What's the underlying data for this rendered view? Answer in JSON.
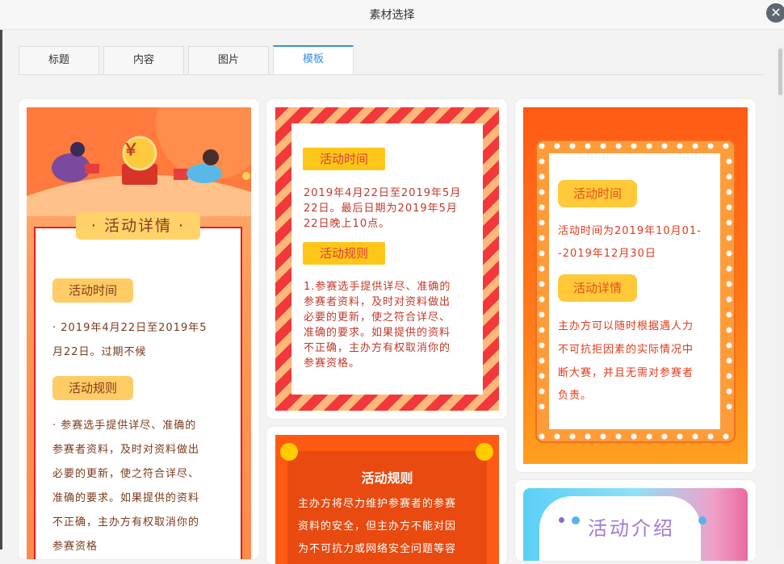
{
  "dialog": {
    "title": "素材选择",
    "close_symbol": "✕"
  },
  "tabs": [
    {
      "label": "标题",
      "active": false
    },
    {
      "label": "内容",
      "active": false
    },
    {
      "label": "图片",
      "active": false
    },
    {
      "label": "模板",
      "active": true
    }
  ],
  "colors": {
    "accent": "#3a8ee6",
    "template_red": "#e03b3b",
    "orange": "#ff6a1a",
    "yellow": "#ffd057"
  },
  "templates": {
    "t1": {
      "coin_symbol": "￥",
      "banner": "· 活动详情 ·",
      "time_heading": "活动时间",
      "time_text_1": "· 2019年4月22日至2019年5",
      "time_text_2": "月22日。过期不候",
      "rules_heading": "活动规则",
      "rules_lines": [
        "· 参赛选手提供详尽、准确的",
        "参赛者资料，及时对资料做出",
        "必要的更新，使之符合详尽、",
        "准确的要求。如果提供的资料",
        "不正确，主办方有权取消你的",
        "参赛资格"
      ]
    },
    "t2": {
      "time_heading": "活动时间",
      "time_lines": [
        "2019年4月22日至2019年5月",
        "22日。最后日期为2019年5月",
        "22日晚上10点。"
      ],
      "rules_heading": "活动规则",
      "rules_lines": [
        "1.参赛选手提供详尽、准确的",
        "参赛者资料，及时对资料做出",
        "必要的更新，使之符合详尽、",
        "准确的要求。如果提供的资料",
        "不正确，主办方有权取消你的",
        "参赛资格。"
      ]
    },
    "t3": {
      "time_heading": "活动时间",
      "time_lines": [
        "活动时间为2019年10月01-",
        "-2019年12月30日"
      ],
      "detail_heading": "活动详情",
      "detail_lines": [
        "主办方可以随时根据遇人力",
        "不可抗拒因素的实际情况中",
        "断大赛，并且无需对参赛者",
        "负责。"
      ]
    },
    "t4": {
      "heading": "活动规则",
      "lines": [
        "主办方将尽力维护参赛者的参赛",
        "资料的安全，但主办方不能对因",
        "为不可抗力或网络安全问题等容"
      ]
    },
    "t5": {
      "heading": "活动介绍"
    }
  }
}
